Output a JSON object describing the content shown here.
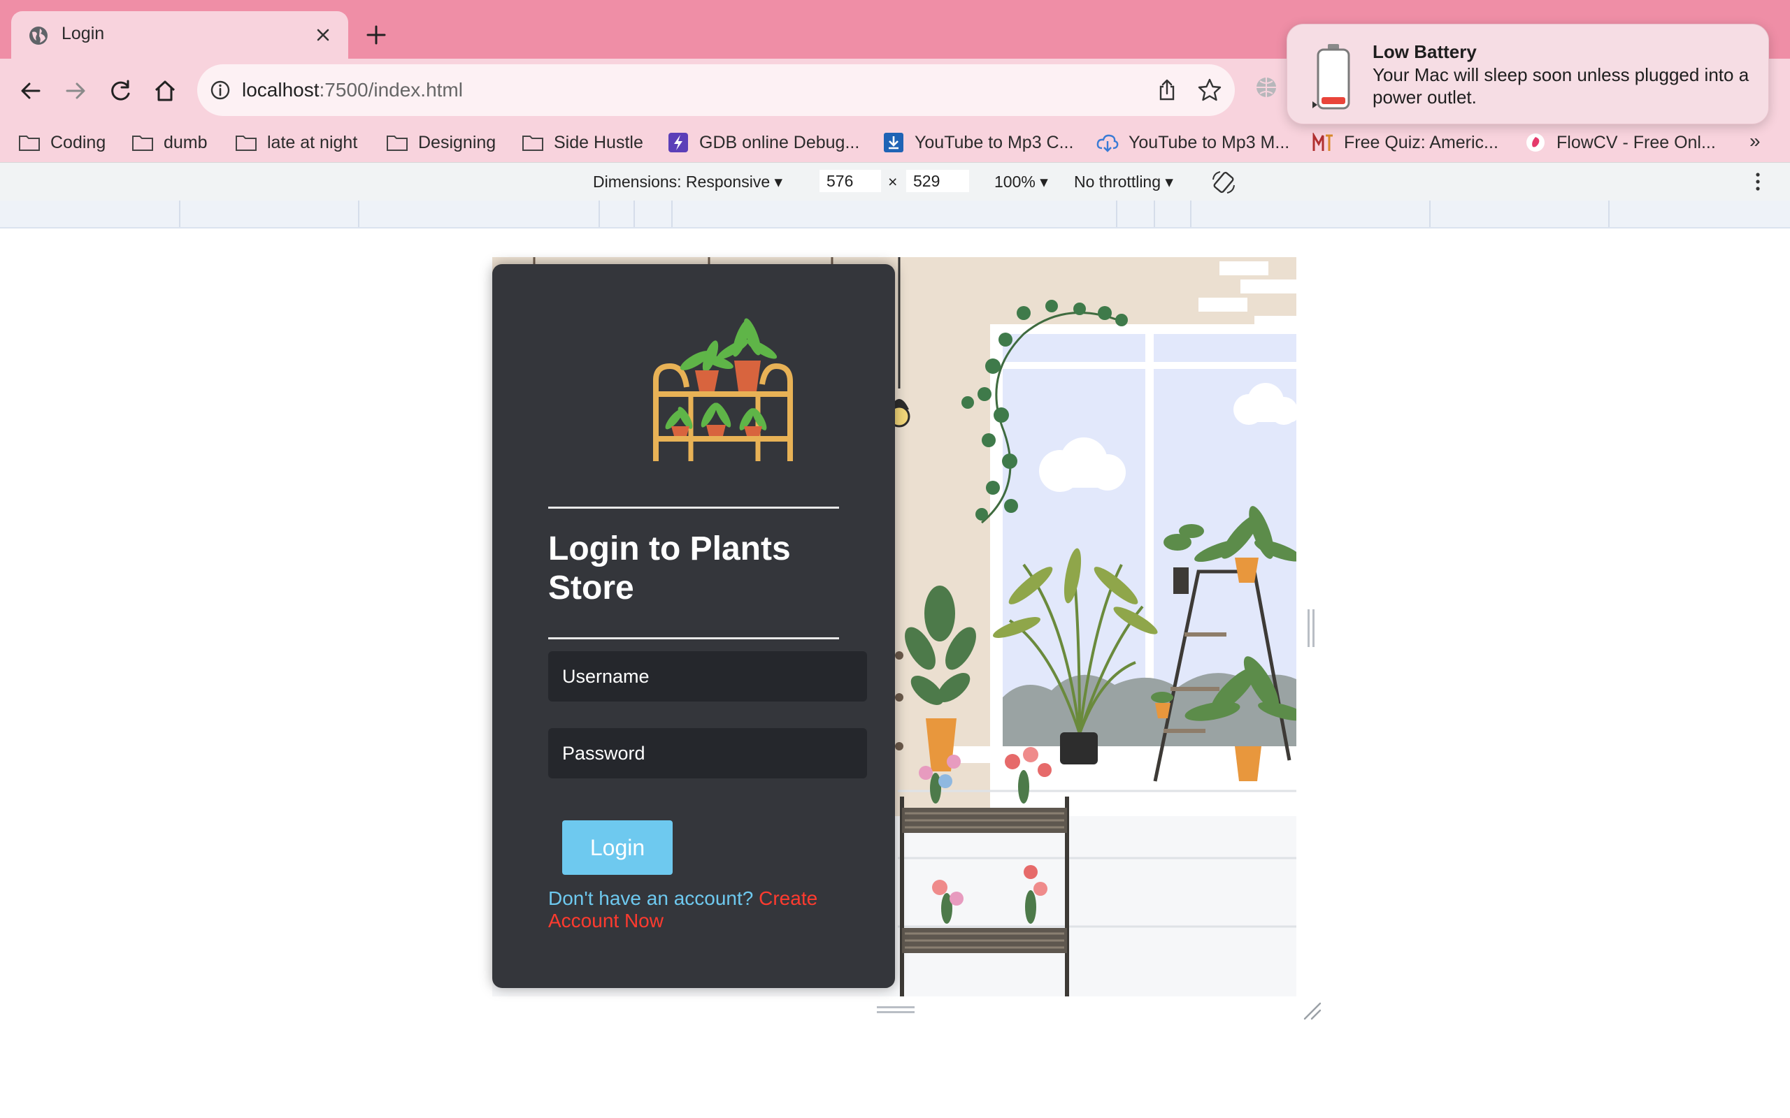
{
  "browser": {
    "tab_title": "Login",
    "url_host": "localhost",
    "url_rest": ":7500/index.html",
    "bookmarks": [
      {
        "label": "Coding",
        "icon": "folder-icon"
      },
      {
        "label": "dumb",
        "icon": "folder-icon"
      },
      {
        "label": "late at night",
        "icon": "folder-icon"
      },
      {
        "label": "Designing",
        "icon": "folder-icon"
      },
      {
        "label": "Side Hustle",
        "icon": "folder-icon"
      },
      {
        "label": "GDB online Debug...",
        "icon": "gdb-icon"
      },
      {
        "label": "YouTube to Mp3 C...",
        "icon": "download-icon"
      },
      {
        "label": "YouTube to Mp3 M...",
        "icon": "cloud-download-icon"
      },
      {
        "label": "Free Quiz: Americ...",
        "icon": "quiz-icon"
      },
      {
        "label": "FlowCV - Free Onl...",
        "icon": "flowcv-icon"
      }
    ],
    "bookmarks_more": "»"
  },
  "devtools": {
    "dimensions_label": "Dimensions: Responsive",
    "width": "576",
    "times": "×",
    "height": "529",
    "zoom": "100%",
    "throttling": "No throttling"
  },
  "notification": {
    "title": "Low Battery",
    "body": "Your Mac will sleep soon unless plugged into a power outlet."
  },
  "login": {
    "heading": "Login to Plants Store",
    "username_placeholder": "Username",
    "password_placeholder": "Password",
    "login_button": "Login",
    "no_account_text": "Don't have an account?",
    "create_account_link": "Create Account Now"
  },
  "colors": {
    "tabstrip": "#ef8ea6",
    "toolbar": "#f8d3dd",
    "card_background": "#34363b",
    "input_background": "#25272c",
    "login_button": "#6ec9ef",
    "link_accent": "#ff3b2f"
  }
}
